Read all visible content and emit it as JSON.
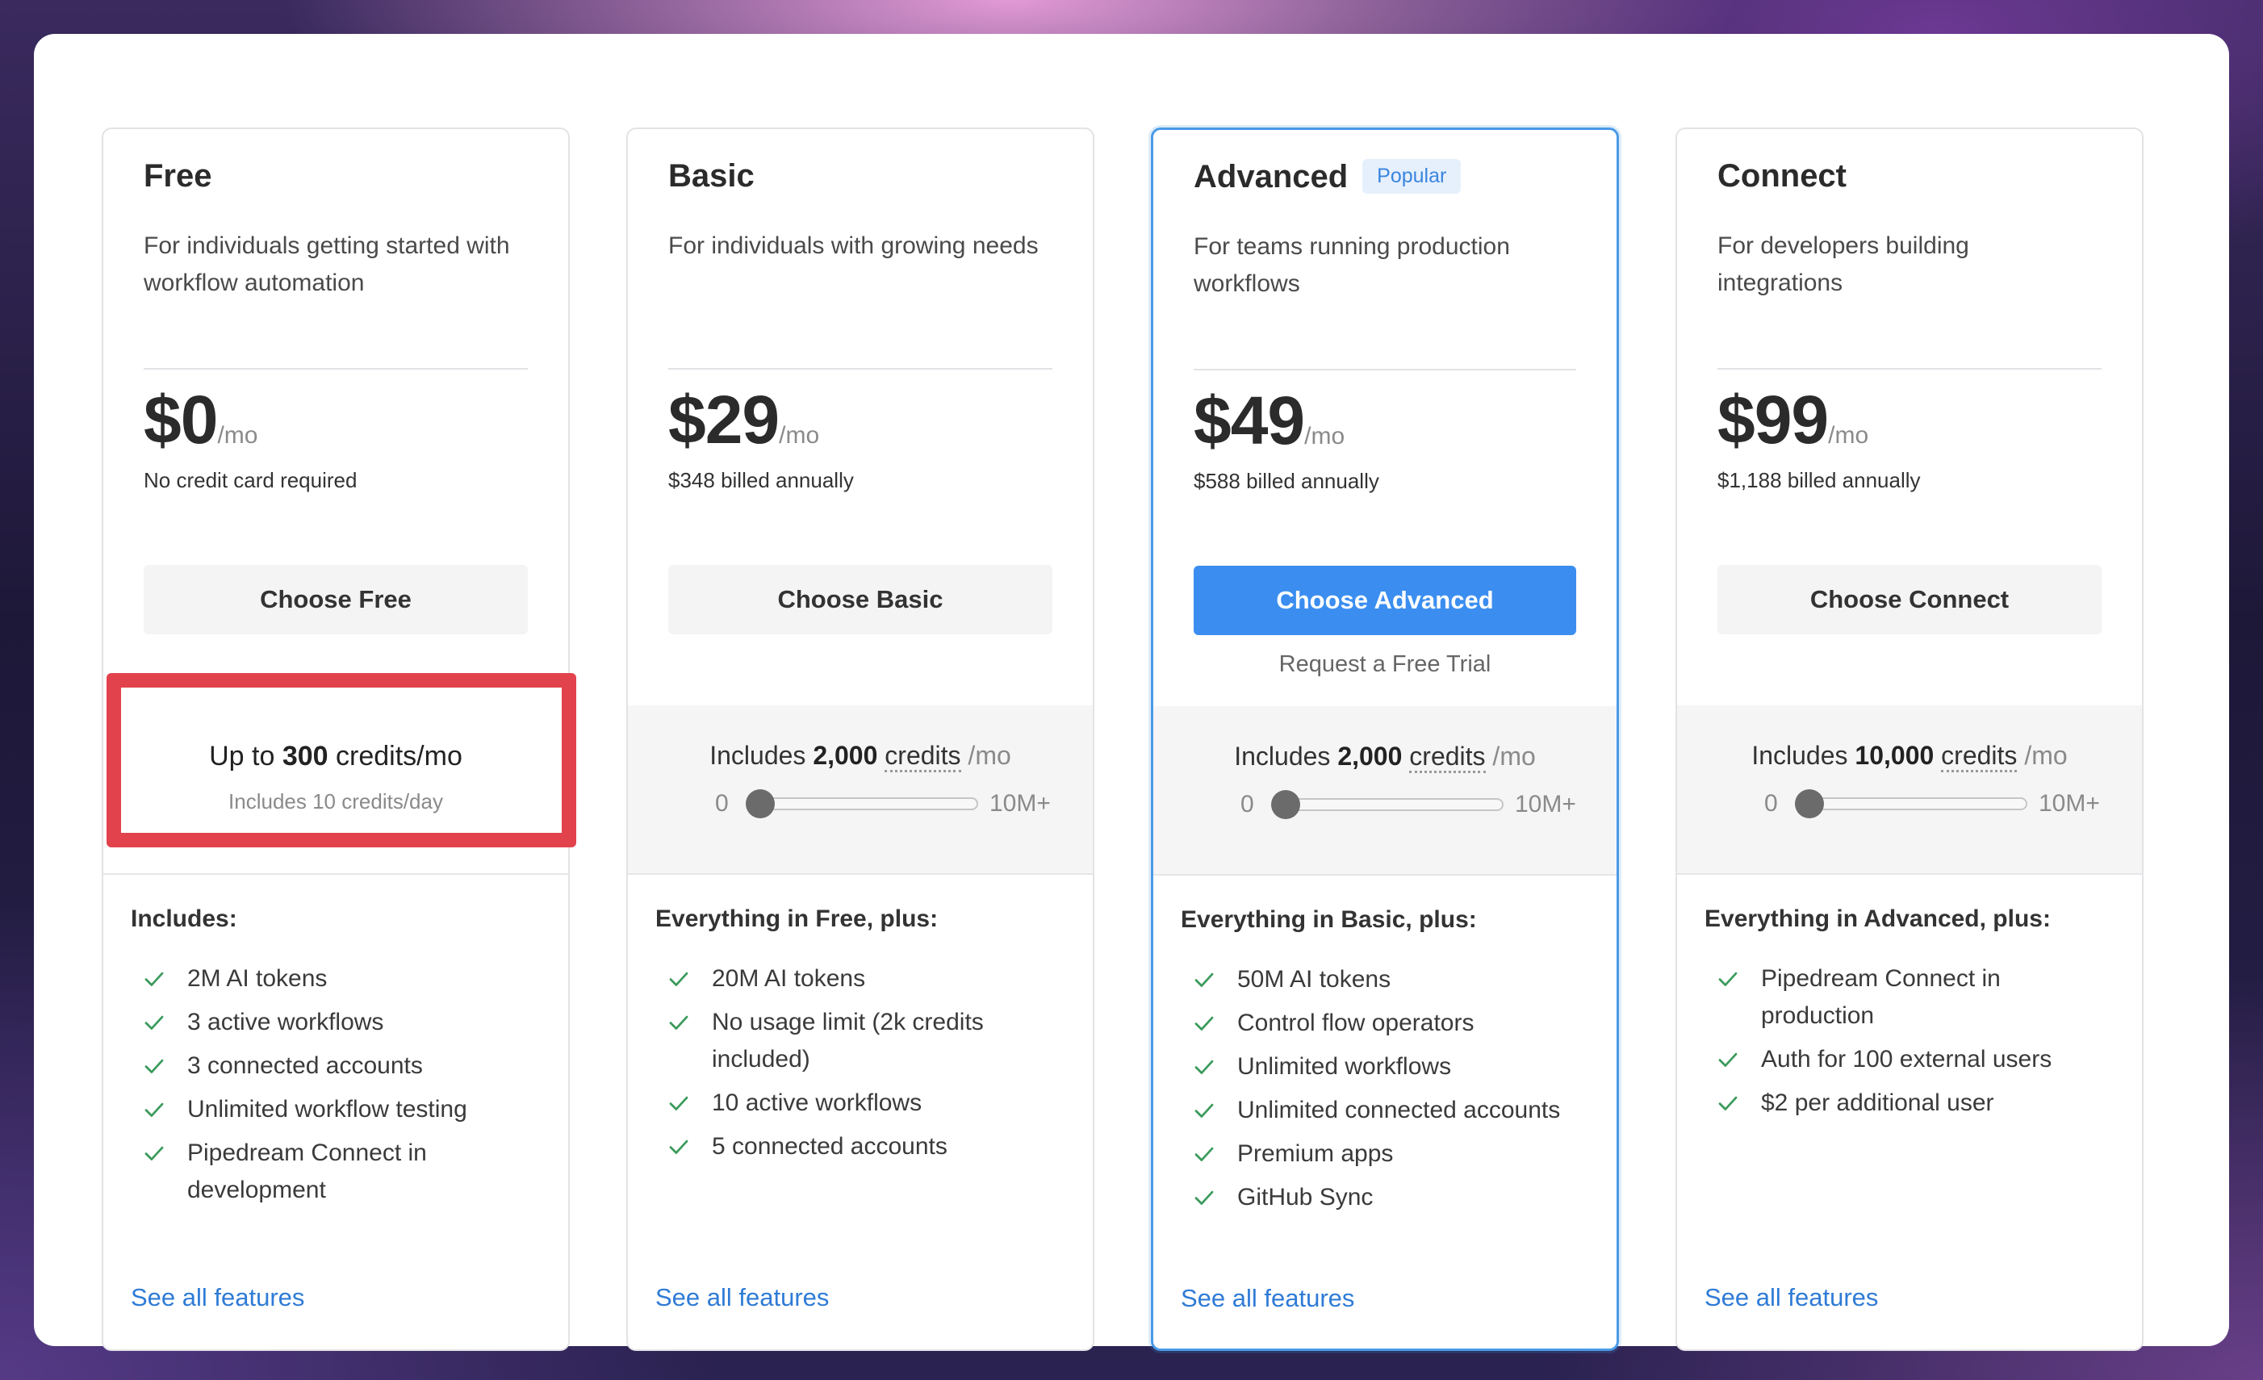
{
  "plans": [
    {
      "name": "Free",
      "badge": "",
      "description": "For individuals getting started with workflow automation",
      "price": "$0",
      "per": "/mo",
      "billing": "No credit card required",
      "button": "Choose Free",
      "trial": "",
      "credits_prefix": "Up to",
      "credits_amount": "300",
      "credits_word": "credits/mo",
      "credits_sub": "Includes 10 credits/day",
      "features_title": "Includes:",
      "features": [
        "2M AI tokens",
        "3 active workflows",
        "3 connected accounts",
        "Unlimited workflow testing",
        "Pipedream Connect in development"
      ],
      "see_all": "See all features"
    },
    {
      "name": "Basic",
      "badge": "",
      "description": "For individuals with growing needs",
      "price": "$29",
      "per": "/mo",
      "billing": "$348 billed annually",
      "button": "Choose Basic",
      "trial": "",
      "credits_prefix": "Includes",
      "credits_amount": "2,000",
      "credits_word": "credits",
      "credits_unit": "/mo",
      "slider_min": "0",
      "slider_max": "10M+",
      "slider_value": 0,
      "features_title": "Everything in Free, plus:",
      "features": [
        "20M AI tokens",
        "No usage limit (2k credits included)",
        "10 active workflows",
        "5 connected accounts"
      ],
      "see_all": "See all features"
    },
    {
      "name": "Advanced",
      "badge": "Popular",
      "description": "For teams running production workflows",
      "price": "$49",
      "per": "/mo",
      "billing": "$588 billed annually",
      "button": "Choose Advanced",
      "trial": "Request a Free Trial",
      "credits_prefix": "Includes",
      "credits_amount": "2,000",
      "credits_word": "credits",
      "credits_unit": "/mo",
      "slider_min": "0",
      "slider_max": "10M+",
      "slider_value": 0,
      "features_title": "Everything in Basic, plus:",
      "features": [
        "50M AI tokens",
        "Control flow operators",
        "Unlimited workflows",
        "Unlimited connected accounts",
        "Premium apps",
        "GitHub Sync"
      ],
      "see_all": "See all features"
    },
    {
      "name": "Connect",
      "badge": "",
      "description": "For developers building integrations",
      "price": "$99",
      "per": "/mo",
      "billing": "$1,188 billed annually",
      "button": "Choose Connect",
      "trial": "",
      "credits_prefix": "Includes",
      "credits_amount": "10,000",
      "credits_word": "credits",
      "credits_unit": "/mo",
      "slider_min": "0",
      "slider_max": "10M+",
      "slider_value": 0,
      "features_title": "Everything in Advanced, plus:",
      "features": [
        "Pipedream Connect in production",
        "Auth for 100 external users",
        "$2 per additional user"
      ],
      "see_all": "See all features"
    }
  ],
  "colors": {
    "accent": "#3b8ef0",
    "featured_border": "#4a9ae6",
    "check": "#3a9a5b",
    "highlight": "#e2424c",
    "link": "#2f7bd6"
  },
  "icons": {
    "feature_check": "check-icon"
  }
}
